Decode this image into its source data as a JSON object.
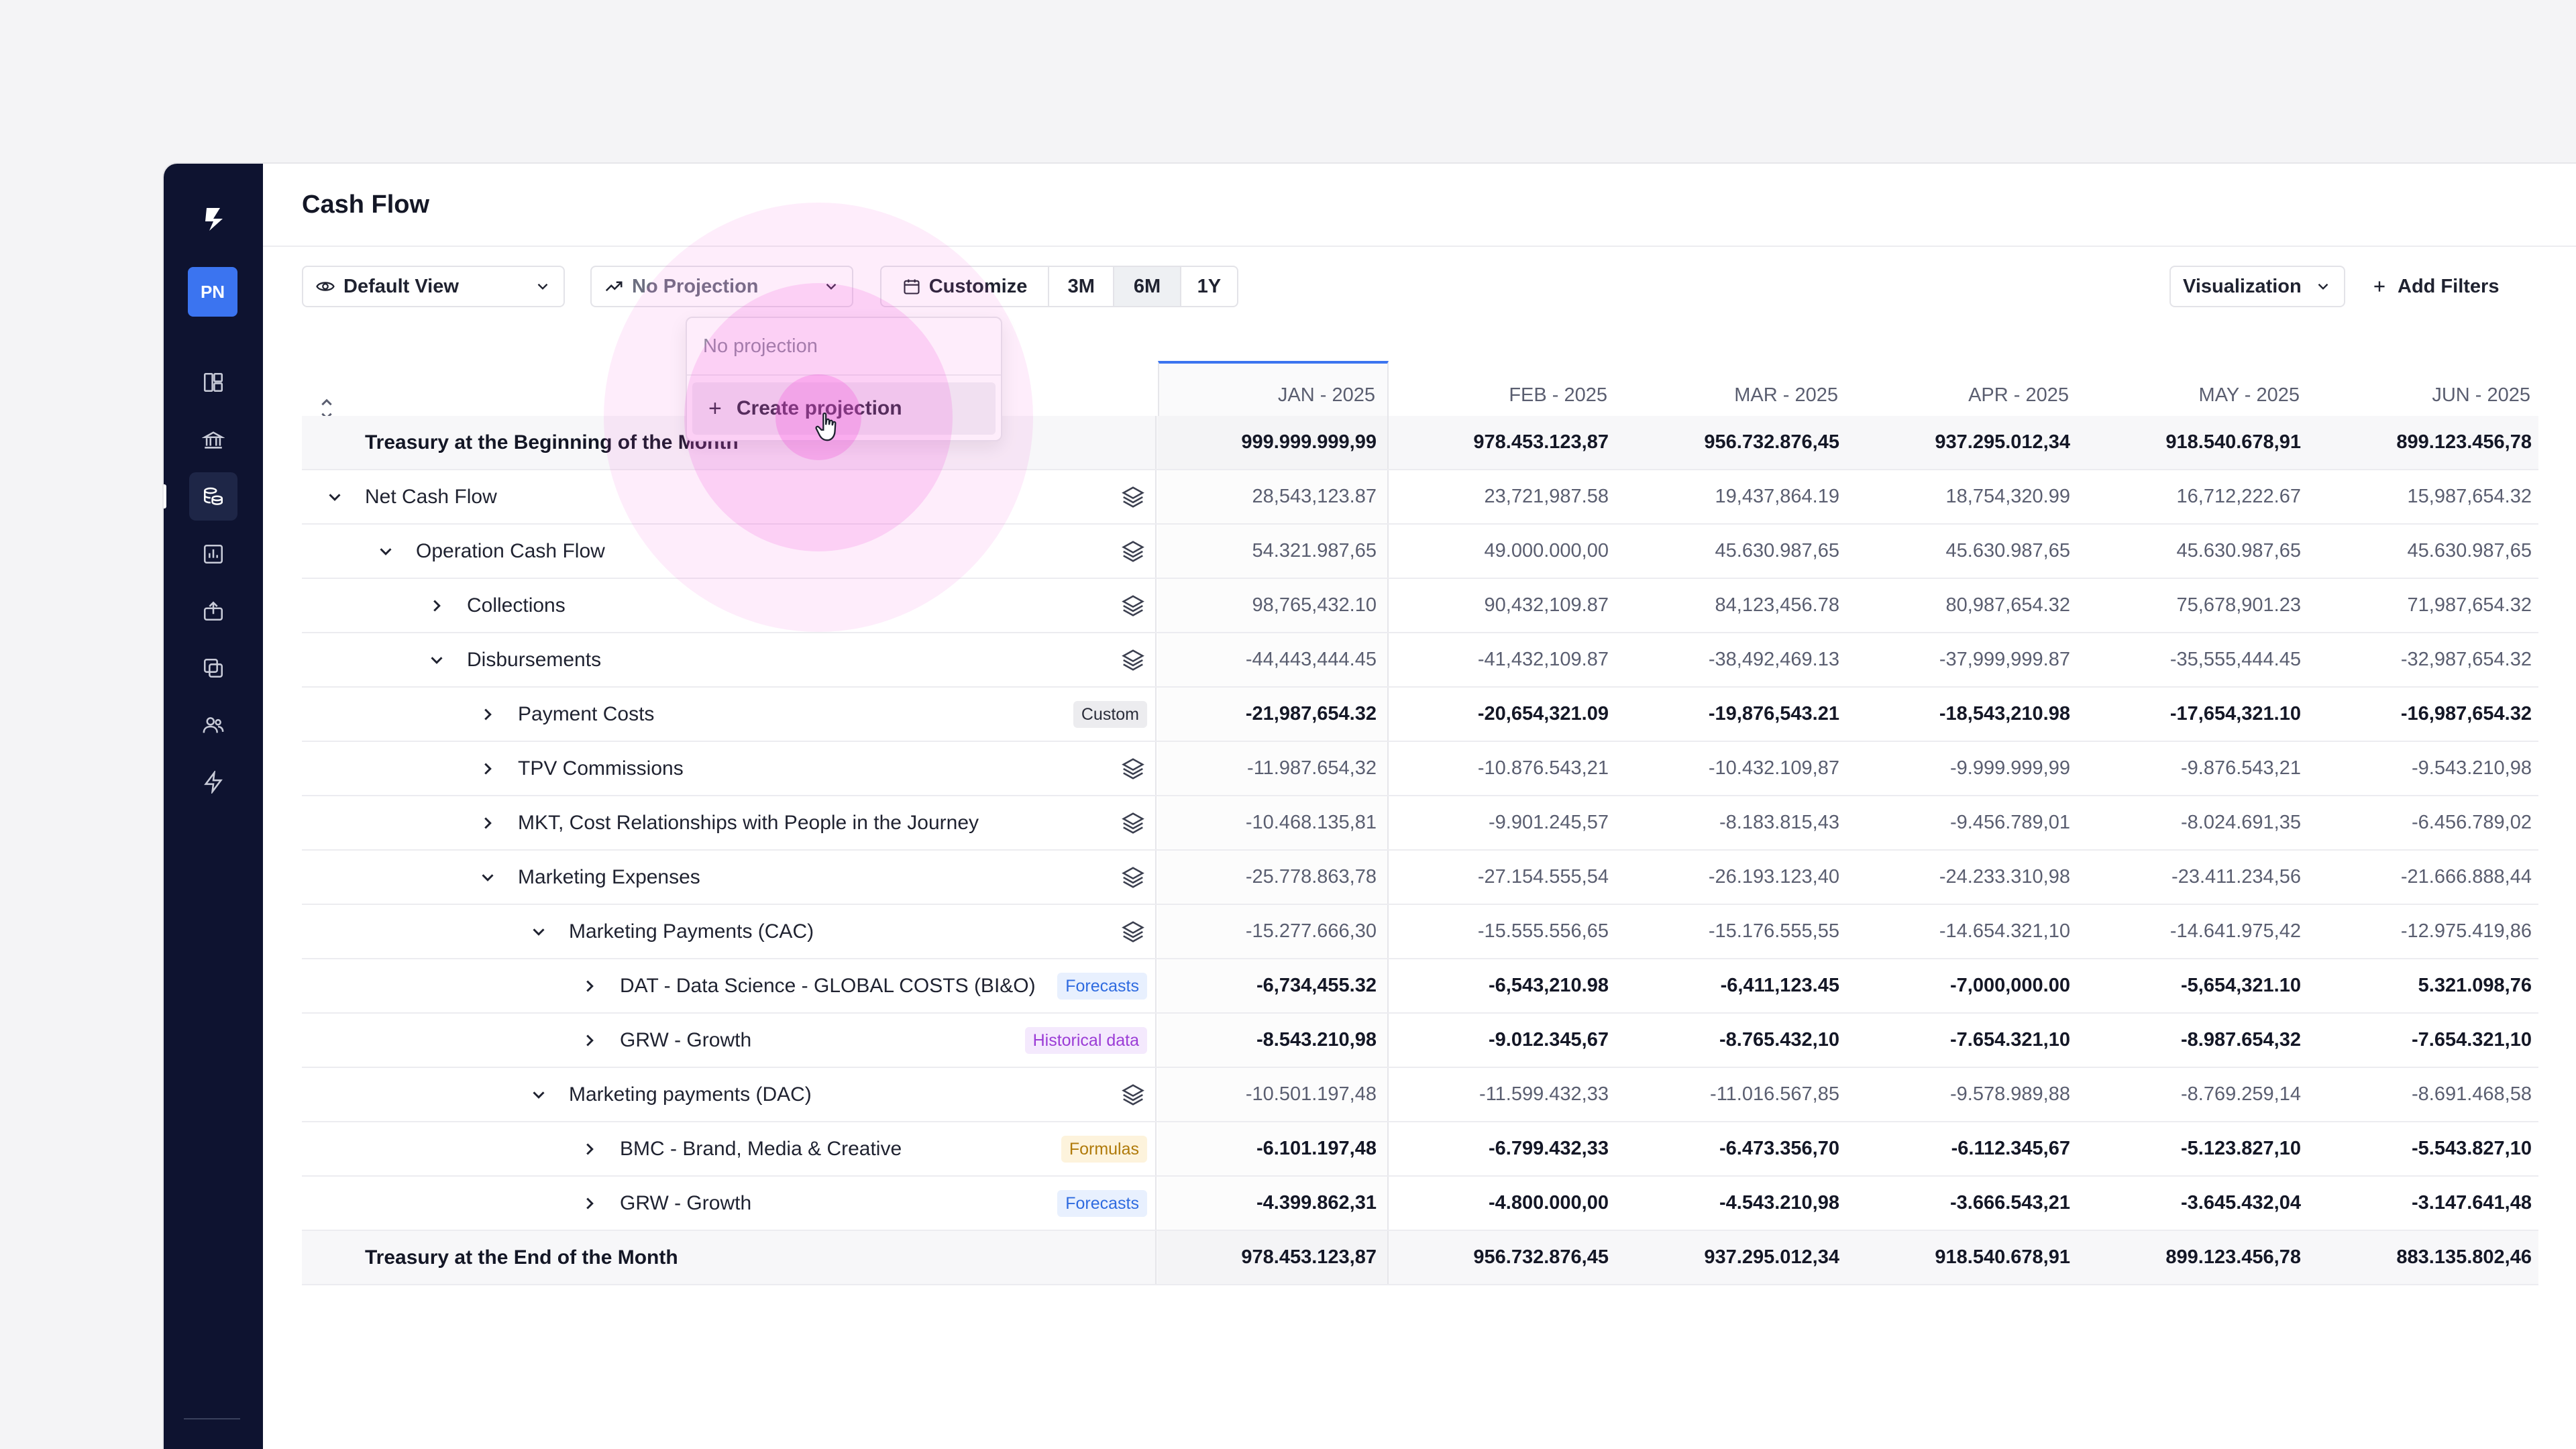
{
  "page": {
    "title": "Cash Flow"
  },
  "sidebar": {
    "avatar_initials": "PN",
    "icons": [
      "logo-icon",
      "dashboard-icon",
      "bank-icon",
      "cashflow-icon",
      "chart-icon",
      "upload-icon",
      "copy-icon",
      "users-icon",
      "lightning-icon"
    ],
    "active_index": 2
  },
  "toolbar": {
    "view_label": "Default View",
    "projection_label": "No Projection",
    "customize_label": "Customize",
    "ranges": [
      "3M",
      "6M",
      "1Y"
    ],
    "active_range": "6M",
    "visualization_label": "Visualization",
    "add_filters_label": "Add Filters"
  },
  "projection_dropdown": {
    "option_none": "No projection",
    "option_create": "Create projection"
  },
  "table": {
    "columns": [
      "JAN - 2025",
      "FEB - 2025",
      "MAR - 2025",
      "APR - 2025",
      "MAY - 2025",
      "JUN - 2025"
    ],
    "rows": [
      {
        "label": "Treasury at the Beginning of the Month",
        "type": "total",
        "values": [
          "999.999.999,99",
          "978.453.123,87",
          "956.732.876,45",
          "937.295.012,34",
          "918.540.678,91",
          "899.123.456,78"
        ]
      },
      {
        "label": "Net Cash Flow",
        "level": 0,
        "caret": "down",
        "icon": "layers",
        "values": [
          "28,543,123.87",
          "23,721,987.58",
          "19,437,864.19",
          "18,754,320.99",
          "16,712,222.67",
          "15,987,654.32"
        ]
      },
      {
        "label": "Operation Cash Flow",
        "level": 1,
        "caret": "down",
        "icon": "layers",
        "values": [
          "54.321.987,65",
          "49.000.000,00",
          "45.630.987,65",
          "45.630.987,65",
          "45.630.987,65",
          "45.630.987,65"
        ]
      },
      {
        "label": "Collections",
        "level": 2,
        "caret": "right",
        "icon": "layers",
        "values": [
          "98,765,432.10",
          "90,432,109.87",
          "84,123,456.78",
          "80,987,654.32",
          "75,678,901.23",
          "71,987,654.32"
        ]
      },
      {
        "label": "Disbursements",
        "level": 2,
        "caret": "down",
        "icon": "layers",
        "values": [
          "-44,443,444.45",
          "-41,432,109.87",
          "-38,492,469.13",
          "-37,999,999.87",
          "-35,555,444.45",
          "-32,987,654.32"
        ]
      },
      {
        "label": "Payment Costs",
        "level": 3,
        "caret": "right",
        "tag": "Custom",
        "tag_style": "custom",
        "bold": true,
        "values": [
          "-21,987,654.32",
          "-20,654,321.09",
          "-19,876,543.21",
          "-18,543,210.98",
          "-17,654,321.10",
          "-16,987,654.32"
        ]
      },
      {
        "label": "TPV Commissions",
        "level": 3,
        "caret": "right",
        "icon": "layers",
        "values": [
          "-11.987.654,32",
          "-10.876.543,21",
          "-10.432.109,87",
          "-9.999.999,99",
          "-9.876.543,21",
          "-9.543.210,98"
        ]
      },
      {
        "label": "MKT, Cost Relationships with People in the Journey",
        "level": 3,
        "caret": "right",
        "icon": "layers",
        "values": [
          "-10.468.135,81",
          "-9.901.245,57",
          "-8.183.815,43",
          "-9.456.789,01",
          "-8.024.691,35",
          "-6.456.789,02"
        ]
      },
      {
        "label": "Marketing Expenses",
        "level": 3,
        "caret": "down",
        "icon": "layers",
        "values": [
          "-25.778.863,78",
          "-27.154.555,54",
          "-26.193.123,40",
          "-24.233.310,98",
          "-23.411.234,56",
          "-21.666.888,44"
        ]
      },
      {
        "label": "Marketing Payments (CAC)",
        "level": 4,
        "caret": "down",
        "icon": "layers",
        "values": [
          "-15.277.666,30",
          "-15.555.556,65",
          "-15.176.555,55",
          "-14.654.321,10",
          "-14.641.975,42",
          "-12.975.419,86"
        ]
      },
      {
        "label": "DAT - Data Science - GLOBAL COSTS (BI&O)",
        "level": 5,
        "caret": "right",
        "tag": "Forecasts",
        "tag_style": "forecasts",
        "bold": true,
        "values": [
          "-6,734,455.32",
          "-6,543,210.98",
          "-6,411,123.45",
          "-7,000,000.00",
          "-5,654,321.10",
          "5.321.098,76"
        ]
      },
      {
        "label": "GRW - Growth",
        "level": 5,
        "caret": "right",
        "tag": "Historical data",
        "tag_style": "historical",
        "bold": true,
        "values": [
          "-8.543.210,98",
          "-9.012.345,67",
          "-8.765.432,10",
          "-7.654.321,10",
          "-8.987.654,32",
          "-7.654.321,10"
        ]
      },
      {
        "label": "Marketing payments (DAC)",
        "level": 4,
        "caret": "down",
        "icon": "layers",
        "values": [
          "-10.501.197,48",
          "-11.599.432,33",
          "-11.016.567,85",
          "-9.578.989,88",
          "-8.769.259,14",
          "-8.691.468,58"
        ]
      },
      {
        "label": "BMC - Brand, Media & Creative",
        "level": 5,
        "caret": "right",
        "tag": "Formulas",
        "tag_style": "formulas",
        "bold": true,
        "values": [
          "-6.101.197,48",
          "-6.799.432,33",
          "-6.473.356,70",
          "-6.112.345,67",
          "-5.123.827,10",
          "-5.543.827,10"
        ]
      },
      {
        "label": "GRW - Growth",
        "level": 5,
        "caret": "right",
        "tag": "Forecasts",
        "tag_style": "forecasts",
        "bold": true,
        "values": [
          "-4.399.862,31",
          "-4.800.000,00",
          "-4.543.210,98",
          "-3.666.543,21",
          "-3.645.432,04",
          "-3.147.641,48"
        ]
      },
      {
        "label": "Treasury at the End of the Month",
        "type": "total",
        "values": [
          "978.453.123,87",
          "956.732.876,45",
          "937.295.012,34",
          "918.540.678,91",
          "899.123.456,78",
          "883.135.802,46"
        ]
      }
    ]
  }
}
